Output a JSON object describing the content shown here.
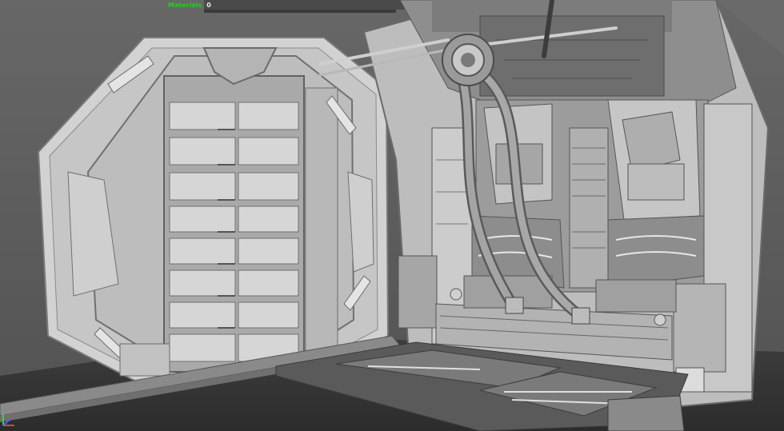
{
  "viewport": {
    "background": "#5d5d5d",
    "hud": {
      "label": "Materials",
      "count": "0",
      "label_color": "#1ed01e",
      "count_color": "#e6e6e6"
    }
  },
  "scene": {
    "shading": "grey-clay",
    "objects": [
      "sci-fi-door",
      "cargo-bay",
      "overhead-pipes",
      "floor-panels",
      "ceiling-rig"
    ]
  },
  "icons": [
    "axis-gizmo-icon"
  ]
}
